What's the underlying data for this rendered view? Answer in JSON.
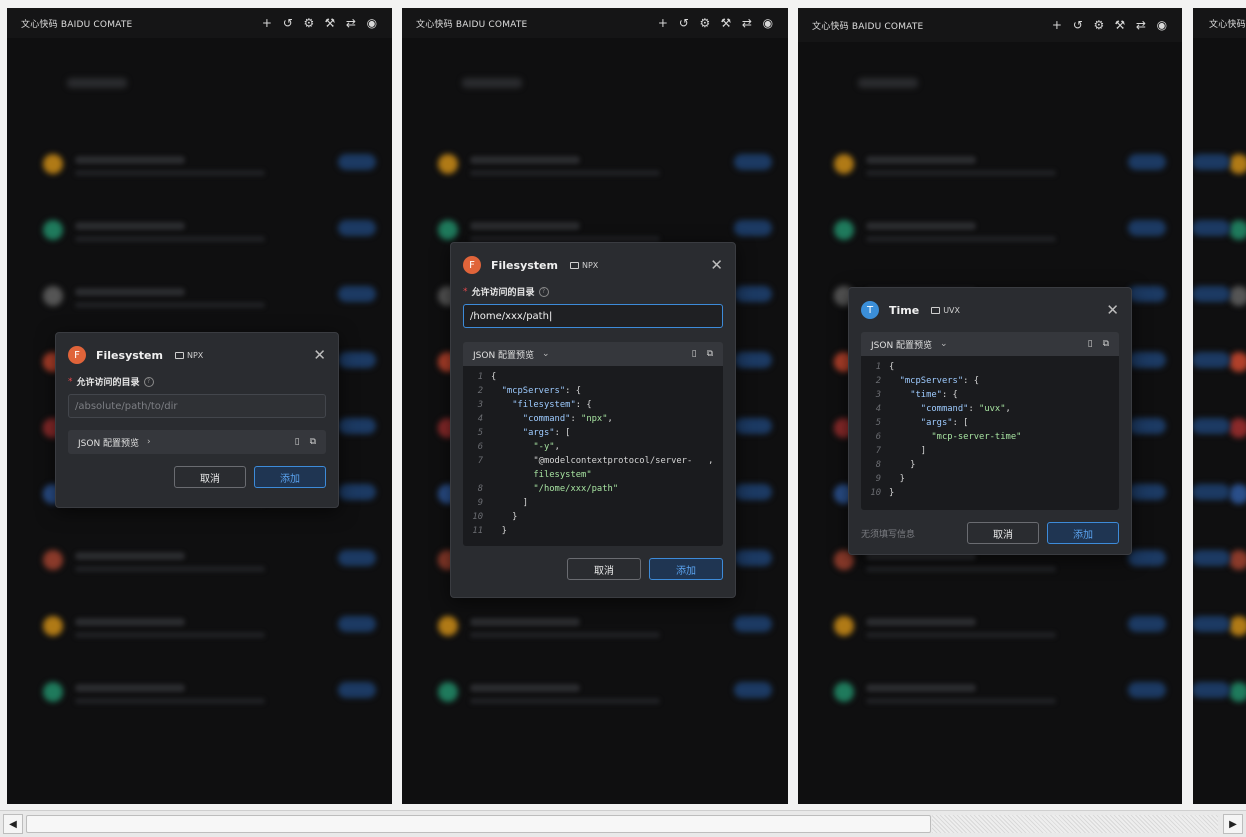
{
  "app_title": "文心快码 BAIDU COMATE",
  "topbar_icons": [
    "plus-icon",
    "history-icon",
    "settings-icon",
    "tools-icon",
    "swap-icon",
    "account-icon"
  ],
  "topbar_glyphs": {
    "plus": "+",
    "history": "↺",
    "settings": "⚙",
    "tools": "⚒",
    "swap": "⇄",
    "account": "◉"
  },
  "labels": {
    "allow_dir": "允许访问的目录",
    "json_preview": "JSON 配置预览",
    "cancel": "取消",
    "add": "添加",
    "no_input_needed": "无须填写信息"
  },
  "dialogs": [
    {
      "name": "Filesystem",
      "avatar_letter": "F",
      "avatar_color": "#e0643a",
      "tag": "NPX",
      "input_placeholder": "/absolute/path/to/dir",
      "input_value": "",
      "json_expanded": false
    },
    {
      "name": "Filesystem",
      "avatar_letter": "F",
      "avatar_color": "#e0643a",
      "tag": "NPX",
      "input_value": "/home/xxx/path",
      "json_expanded": true,
      "code_lines": [
        {
          "n": "1",
          "t": "{"
        },
        {
          "n": "2",
          "t": "  \"mcpServers\": {"
        },
        {
          "n": "3",
          "t": "    \"filesystem\": {"
        },
        {
          "n": "4",
          "t": "      \"command\": \"npx\","
        },
        {
          "n": "5",
          "t": "      \"args\": ["
        },
        {
          "n": "6",
          "t": "        \"-y\","
        },
        {
          "n": "7",
          "t": "        \"@modelcontextprotocol/server-   ,"
        },
        {
          "n": "",
          "t": "        filesystem\""
        },
        {
          "n": "8",
          "t": "        \"/home/xxx/path\""
        },
        {
          "n": "9",
          "t": "      ]"
        },
        {
          "n": "10",
          "t": "    }"
        },
        {
          "n": "11",
          "t": "  }"
        }
      ]
    },
    {
      "name": "Time",
      "avatar_letter": "T",
      "avatar_color": "#3b8fd9",
      "tag": "UVX",
      "json_expanded": true,
      "code_lines": [
        {
          "n": "1",
          "t": "{"
        },
        {
          "n": "2",
          "t": "  \"mcpServers\": {"
        },
        {
          "n": "3",
          "t": "    \"time\": {"
        },
        {
          "n": "4",
          "t": "      \"command\": \"uvx\","
        },
        {
          "n": "5",
          "t": "      \"args\": ["
        },
        {
          "n": "6",
          "t": "        \"mcp-server-time\""
        },
        {
          "n": "7",
          "t": "      ]"
        },
        {
          "n": "8",
          "t": "    }"
        },
        {
          "n": "9",
          "t": "  }"
        },
        {
          "n": "10",
          "t": "}"
        }
      ]
    }
  ],
  "panel4_title_partial": "文心快码"
}
